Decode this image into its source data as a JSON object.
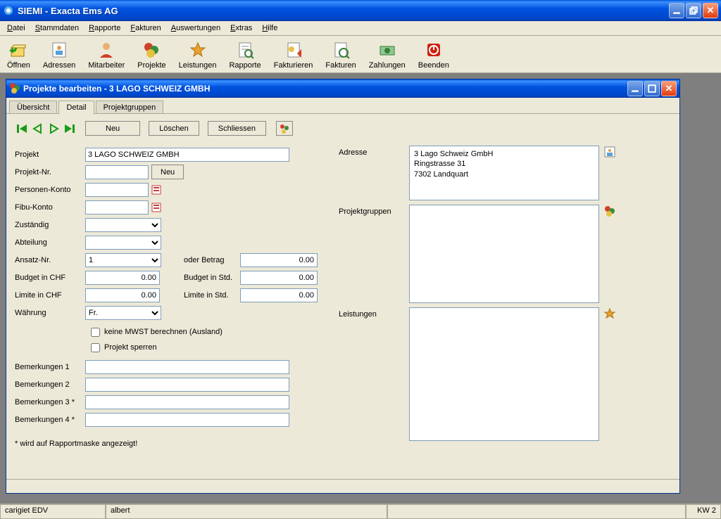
{
  "app": {
    "title": "SIEMI - Exacta Ems AG"
  },
  "menu": {
    "datei": "Datei",
    "stammdaten": "Stammdaten",
    "rapporte": "Rapporte",
    "fakturen": "Fakturen",
    "auswertungen": "Auswertungen",
    "extras": "Extras",
    "hilfe": "Hilfe"
  },
  "toolbar": {
    "oeffnen": "Öffnen",
    "adressen": "Adressen",
    "mitarbeiter": "Mitarbeiter",
    "projekte": "Projekte",
    "leistungen": "Leistungen",
    "rapporte": "Rapporte",
    "fakturieren": "Fakturieren",
    "fakturen": "Fakturen",
    "zahlungen": "Zahlungen",
    "beenden": "Beenden"
  },
  "child": {
    "title": "Projekte bearbeiten - 3 LAGO SCHWEIZ GMBH",
    "tabs": {
      "uebersicht": "Übersicht",
      "detail": "Detail",
      "projektgruppen": "Projektgruppen"
    },
    "buttons": {
      "neu": "Neu",
      "loeschen": "Löschen",
      "schliessen": "Schliessen"
    }
  },
  "form": {
    "projekt_label": "Projekt",
    "projekt_value": "3 LAGO SCHWEIZ GMBH",
    "projektnr_label": "Projekt-Nr.",
    "projektnr_value": "",
    "projektnr_neu": "Neu",
    "personenkonto_label": "Personen-Konto",
    "personenkonto_value": "",
    "fibukonto_label": "Fibu-Konto",
    "fibukonto_value": "",
    "zustaendig_label": "Zuständig",
    "zustaendig_value": "",
    "abteilung_label": "Abteilung",
    "abteilung_value": "",
    "ansatznr_label": "Ansatz-Nr.",
    "ansatznr_value": "1",
    "oderbetrag_label": "oder Betrag",
    "oderbetrag_value": "0.00",
    "budgetchf_label": "Budget in CHF",
    "budgetchf_value": "0.00",
    "budgetstd_label": "Budget in Std.",
    "budgetstd_value": "0.00",
    "limitechf_label": "Limite in CHF",
    "limitechf_value": "0.00",
    "limitestd_label": "Limite in Std.",
    "limitestd_value": "0.00",
    "waehrung_label": "Währung",
    "waehrung_value": "Fr.",
    "mwst_label": "keine MWST berechnen (Ausland)",
    "sperren_label": "Projekt sperren",
    "bem1_label": "Bemerkungen 1",
    "bem1_value": "",
    "bem2_label": "Bemerkungen 2",
    "bem2_value": "",
    "bem3_label": "Bemerkungen 3 *",
    "bem3_value": "",
    "bem4_label": "Bemerkungen 4 *",
    "bem4_value": "",
    "footnote": "* wird auf Rapportmaske angezeigt!"
  },
  "right": {
    "adresse_label": "Adresse",
    "adresse_line1": "3 Lago Schweiz GmbH",
    "adresse_line2": "Ringstrasse 31",
    "adresse_line3": "7302 Landquart",
    "projektgruppen_label": "Projektgruppen",
    "leistungen_label": "Leistungen"
  },
  "status": {
    "left": "carigiet EDV",
    "user": "albert",
    "kw": "KW 2"
  }
}
